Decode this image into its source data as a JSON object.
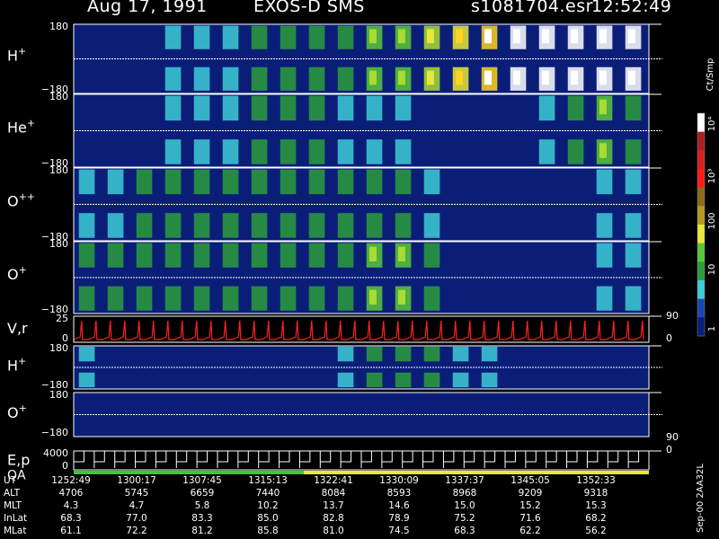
{
  "header": {
    "date": "Aug 17, 1991",
    "instrument": "EXOS-D SMS",
    "file": "s1081704.esr",
    "time": "12:52:49"
  },
  "colors": {
    "background": "#000000",
    "spectrogram_bg": "#0a1e78",
    "velocity_trace": "#ff2020",
    "qa_green": "#3ac83a",
    "qa_yellow": "#e8e83a"
  },
  "chart_data": [
    {
      "type": "heatmap",
      "name_label": "H",
      "superscript": "+",
      "y_ticks": [
        "180",
        "−180"
      ],
      "ylim": [
        -180,
        180
      ],
      "intensity": [
        1,
        1,
        1,
        2,
        2,
        2,
        3,
        3,
        3,
        3,
        4,
        4,
        5,
        6,
        7,
        8,
        8,
        9,
        9,
        9
      ]
    },
    {
      "type": "heatmap",
      "name_label": "He",
      "superscript": "+",
      "y_ticks": [
        "180",
        "−180"
      ],
      "ylim": [
        -180,
        180
      ],
      "intensity": [
        1,
        1,
        1,
        2,
        2,
        2,
        3,
        3,
        3,
        2,
        2,
        2,
        1,
        1,
        1,
        1,
        2,
        3,
        4,
        3
      ]
    },
    {
      "type": "heatmap",
      "name_label": "O",
      "superscript": "++",
      "y_ticks": [
        "180",
        "−180"
      ],
      "ylim": [
        -180,
        180
      ],
      "intensity": [
        2,
        2,
        3,
        3,
        3,
        3,
        3,
        3,
        3,
        3,
        3,
        3,
        2,
        1,
        1,
        1,
        1,
        1,
        2,
        2
      ]
    },
    {
      "type": "heatmap",
      "name_label": "O",
      "superscript": "+",
      "y_ticks": [
        "180",
        "−180"
      ],
      "ylim": [
        -180,
        180
      ],
      "intensity": [
        3,
        3,
        3,
        3,
        3,
        3,
        3,
        3,
        3,
        3,
        4,
        4,
        3,
        1,
        1,
        1,
        1,
        1,
        2,
        2
      ]
    },
    {
      "type": "line",
      "name_label": "V,r",
      "y_ticks": [
        "25",
        "0"
      ],
      "right_ticks": [
        "90",
        "0"
      ],
      "ylim": [
        0,
        25
      ]
    },
    {
      "type": "heatmap",
      "name_label": "H",
      "superscript": "+",
      "y_ticks": [
        "180",
        "−180"
      ],
      "ylim": [
        -180,
        180
      ],
      "intensity": [
        2,
        1,
        1,
        1,
        1,
        1,
        1,
        1,
        1,
        2,
        3,
        3,
        3,
        2,
        2,
        1,
        1,
        1,
        1,
        1
      ]
    },
    {
      "type": "heatmap",
      "name_label": "O",
      "superscript": "+",
      "y_ticks": [
        "180",
        "−180"
      ],
      "right_ticks": [
        "90"
      ],
      "ylim": [
        -180,
        180
      ],
      "intensity": [
        1,
        1,
        1,
        1,
        1,
        1,
        1,
        1,
        1,
        1,
        1,
        1,
        1,
        1,
        1,
        1,
        1,
        1,
        1,
        1
      ]
    },
    {
      "type": "line",
      "name_label": "E,p",
      "name_label_2": "QA",
      "y_ticks": [
        "4000",
        "0"
      ],
      "right_ticks": [
        "0"
      ],
      "ylim": [
        0,
        4000
      ]
    }
  ],
  "colorbar": {
    "unit": "Ct/Smp",
    "labels": [
      "10⁴",
      "10³",
      "100",
      "10",
      "1"
    ],
    "scale": "log",
    "range": [
      1,
      10000
    ]
  },
  "ephemeris": {
    "rows": [
      {
        "label": "UT",
        "values": [
          "1252:49",
          "1300:17",
          "1307:45",
          "1315:13",
          "1322:41",
          "1330:09",
          "1337:37",
          "1345:05",
          "1352:33"
        ]
      },
      {
        "label": "ALT",
        "values": [
          "4706",
          "5745",
          "6659",
          "7440",
          "8084",
          "8593",
          "8968",
          "9209",
          "9318"
        ]
      },
      {
        "label": "MLT",
        "values": [
          "4.3",
          "4.7",
          "5.8",
          "10.2",
          "13.7",
          "14.6",
          "15.0",
          "15.2",
          "15.3"
        ]
      },
      {
        "label": "InLat",
        "values": [
          "68.3",
          "77.0",
          "83.3",
          "85.0",
          "82.8",
          "78.9",
          "75.2",
          "71.6",
          "68.2"
        ]
      },
      {
        "label": "MLat",
        "values": [
          "61.1",
          "72.2",
          "81.2",
          "85.8",
          "81.0",
          "74.5",
          "68.3",
          "62.2",
          "56.2"
        ]
      }
    ]
  },
  "footer": {
    "code": "Sep-00 2AA32L"
  }
}
